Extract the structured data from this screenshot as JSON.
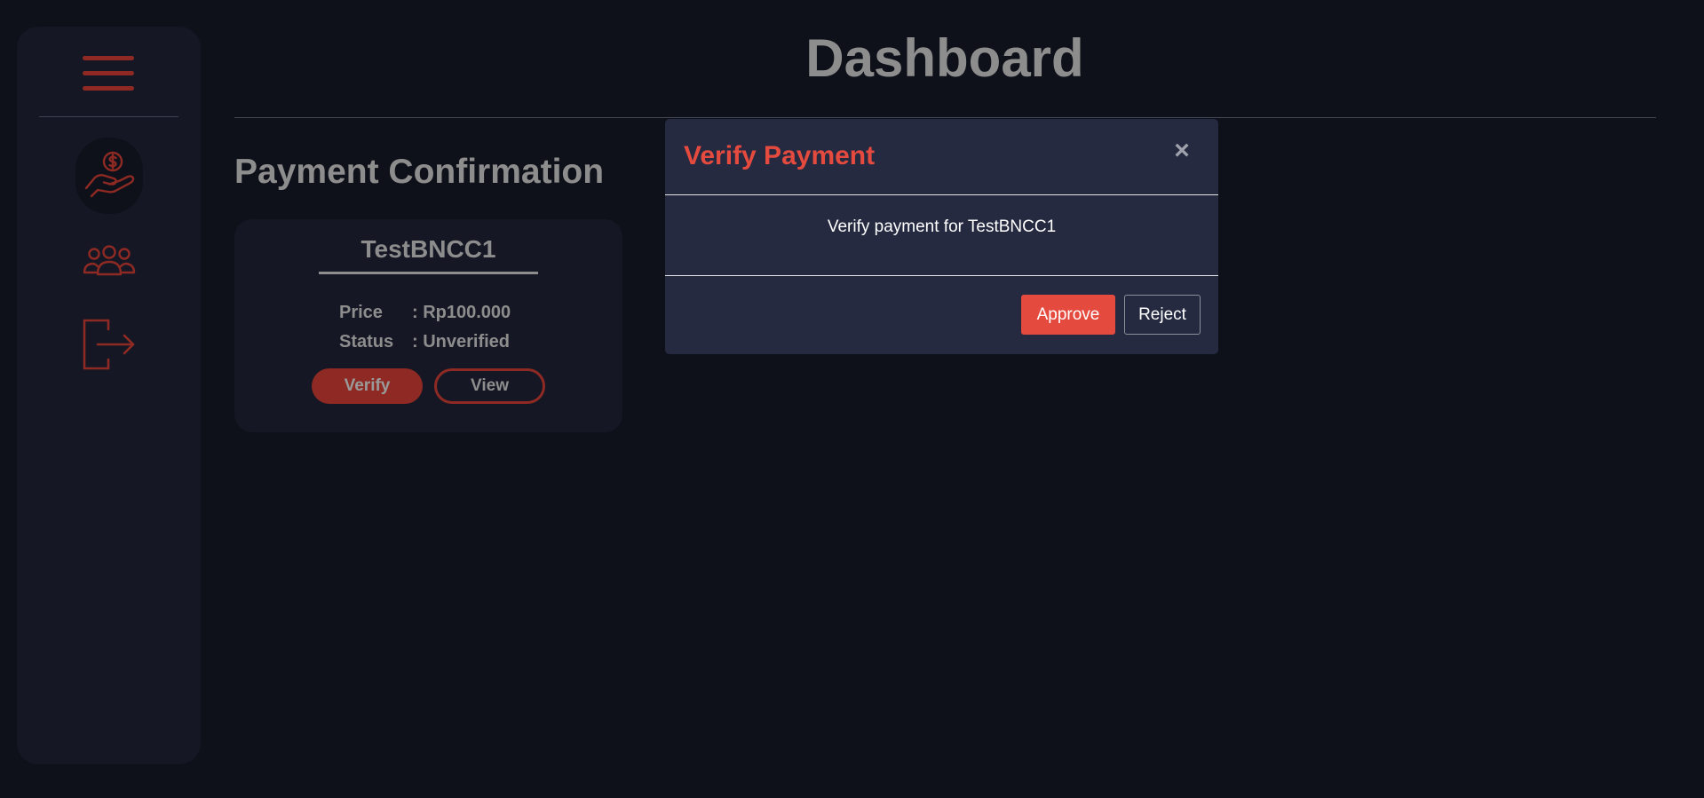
{
  "header": {
    "title": "Dashboard"
  },
  "sidebar": {
    "menu_icon": "hamburger-menu-icon",
    "items": [
      {
        "name": "payment",
        "icon": "hand-holding-dollar-icon",
        "active": true
      },
      {
        "name": "users",
        "icon": "users-group-icon",
        "active": false
      },
      {
        "name": "logout",
        "icon": "logout-icon",
        "active": false
      }
    ]
  },
  "section": {
    "title": "Payment Confirmation"
  },
  "card": {
    "title": "TestBNCC1",
    "price_label": "Price",
    "price_value": ": Rp100.000",
    "status_label": "Status",
    "status_value": ": Unverified",
    "verify_label": "Verify",
    "view_label": "View"
  },
  "modal": {
    "title": "Verify Payment",
    "close_symbol": "×",
    "message": "Verify payment for TestBNCC1",
    "approve_label": "Approve",
    "reject_label": "Reject"
  },
  "colors": {
    "background": "#0e1119",
    "sidebar": "#151824",
    "accent": "#8e2a23",
    "modal_background": "#262a41",
    "modal_title": "#e54a3e",
    "approve_button": "#e54a3e",
    "muted_text": "#8d8d8d"
  }
}
